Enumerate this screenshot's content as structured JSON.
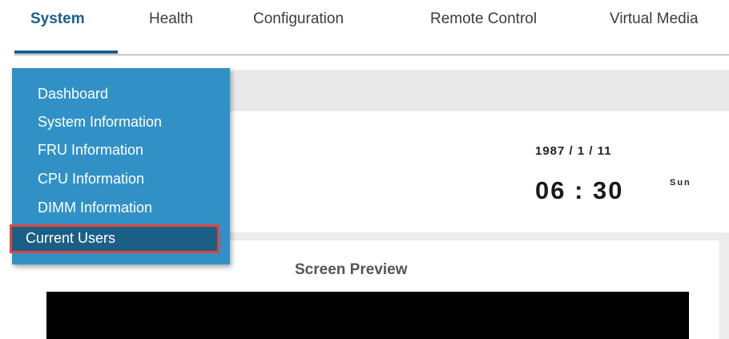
{
  "nav": {
    "tabs": [
      {
        "label": "System"
      },
      {
        "label": "Health"
      },
      {
        "label": "Configuration"
      },
      {
        "label": "Remote Control"
      },
      {
        "label": "Virtual Media"
      }
    ],
    "active_tab": "System"
  },
  "system_menu": {
    "items": [
      {
        "label": "Dashboard"
      },
      {
        "label": "System Information"
      },
      {
        "label": "FRU Information"
      },
      {
        "label": "CPU Information"
      },
      {
        "label": "DIMM Information"
      },
      {
        "label": "Current Users"
      }
    ],
    "selected_item": "Current Users"
  },
  "clock": {
    "date": "1987 / 1 / 11",
    "time": "06 : 30",
    "day": "Sun"
  },
  "preview": {
    "title": "Screen Preview"
  },
  "colors": {
    "accent": "#1b5f8f",
    "menu_bg": "#3191c7",
    "menu_selected_bg": "#1c5f86",
    "highlight_border": "#e2453d"
  }
}
